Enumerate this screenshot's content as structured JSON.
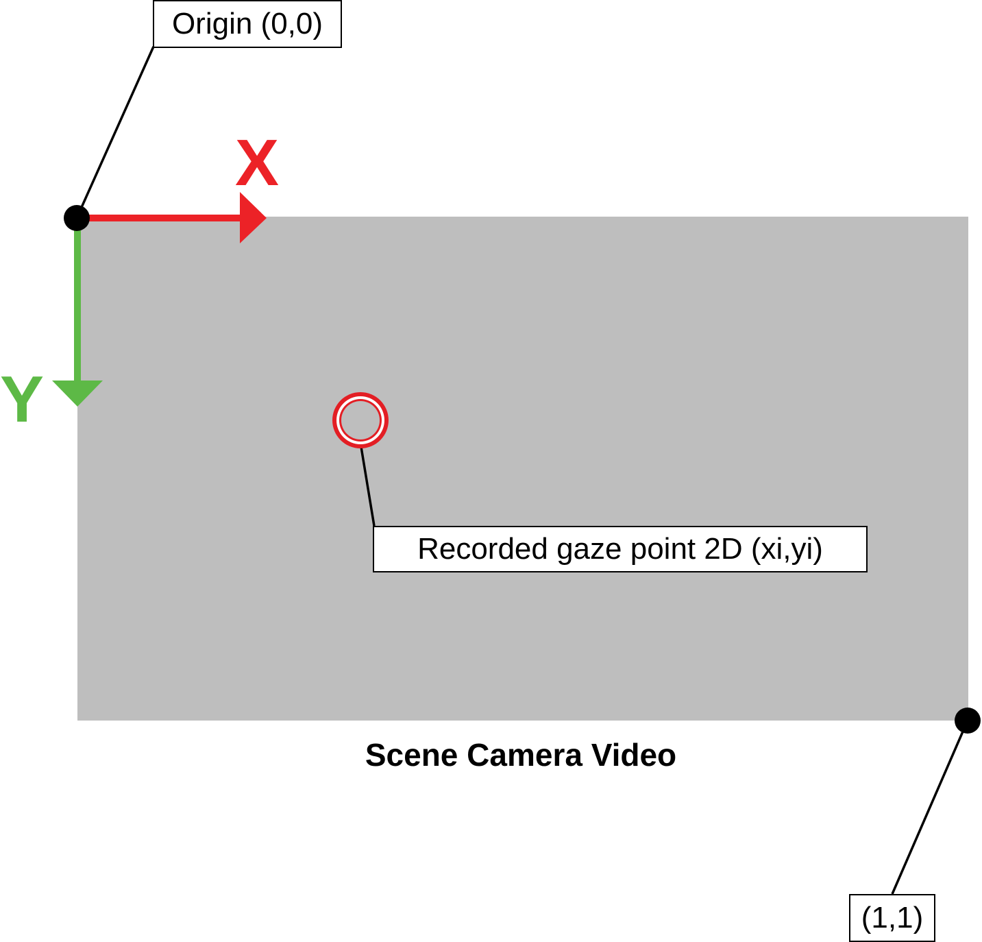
{
  "labels": {
    "origin": "Origin (0,0)",
    "gaze_point": "Recorded gaze point 2D (xi,yi)",
    "end_corner": "(1,1)",
    "scene_caption": "Scene Camera Video"
  },
  "axes": {
    "x_label": "X",
    "y_label": "Y"
  },
  "colors": {
    "x_axis": "#ec2227",
    "y_axis": "#5db946",
    "scene_fill": "#bebebe",
    "gaze_marker": "#e31e24",
    "dots": "#000000"
  }
}
